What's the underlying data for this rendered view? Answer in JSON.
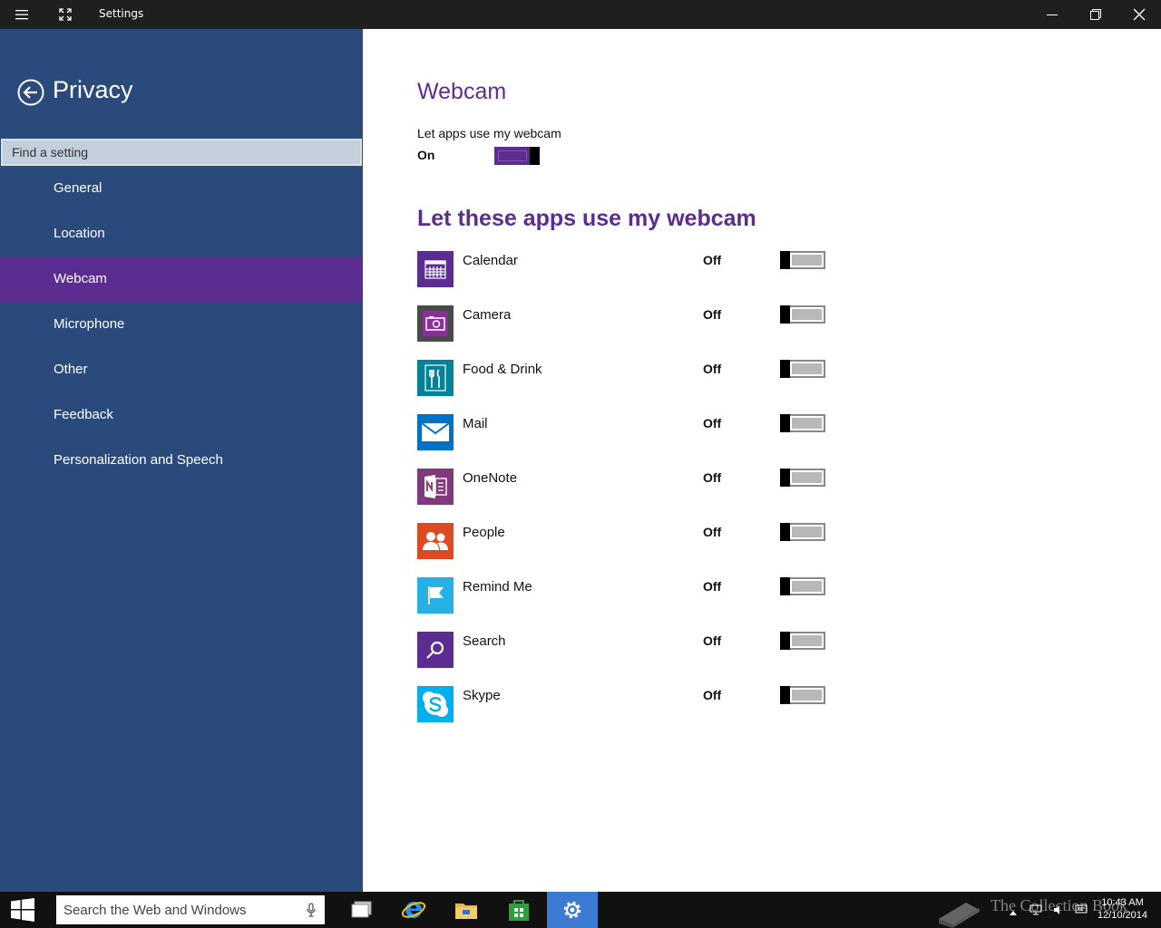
{
  "window": {
    "title": "Settings",
    "menu_icon": "hamburger-icon",
    "fullscreen_icon": "expand-icon",
    "controls": [
      "minimize-icon",
      "restore-icon",
      "close-icon"
    ]
  },
  "sidebar": {
    "title": "Privacy",
    "back_icon": "back-arrow-icon",
    "search_placeholder": "Find a setting",
    "items": [
      {
        "label": "General",
        "active": false
      },
      {
        "label": "Location",
        "active": false
      },
      {
        "label": "Webcam",
        "active": true
      },
      {
        "label": "Microphone",
        "active": false
      },
      {
        "label": "Other",
        "active": false
      },
      {
        "label": "Feedback",
        "active": false
      },
      {
        "label": "Personalization and Speech",
        "active": false
      }
    ]
  },
  "main": {
    "heading": "Webcam",
    "master_label": "Let apps use my webcam",
    "master_state": "On",
    "master_value": true,
    "apps_heading": "Let these apps use my webcam",
    "apps": [
      {
        "name": "Calendar",
        "state": "Off",
        "icon": "calendar-icon",
        "color": "#5c2d91"
      },
      {
        "name": "Camera",
        "state": "Off",
        "icon": "camera-icon",
        "color": "#4a4a4a"
      },
      {
        "name": "Food & Drink",
        "state": "Off",
        "icon": "fork-knife-icon",
        "color": "#008299"
      },
      {
        "name": "Mail",
        "state": "Off",
        "icon": "mail-icon",
        "color": "#0072c6"
      },
      {
        "name": "OneNote",
        "state": "Off",
        "icon": "onenote-icon",
        "color": "#80397b"
      },
      {
        "name": "People",
        "state": "Off",
        "icon": "people-icon",
        "color": "#dc4a22"
      },
      {
        "name": "Remind Me",
        "state": "Off",
        "icon": "flag-icon",
        "color": "#25b0e6"
      },
      {
        "name": "Search",
        "state": "Off",
        "icon": "search-icon",
        "color": "#5c2d91"
      },
      {
        "name": "Skype",
        "state": "Off",
        "icon": "skype-icon",
        "color": "#00aff0"
      }
    ]
  },
  "taskbar": {
    "search_placeholder": "Search the Web and Windows",
    "apps": [
      "task-view-icon",
      "internet-explorer-icon",
      "file-explorer-icon",
      "store-icon",
      "settings-icon"
    ],
    "time": "10:43 AM",
    "date": "12/10/2014",
    "watermark": "The Collection Book"
  },
  "colors": {
    "sidebar_bg": "#2b4a7c",
    "accent": "#5c2d91",
    "titlebar": "#1f1f1f",
    "taskbar": "#111111"
  }
}
